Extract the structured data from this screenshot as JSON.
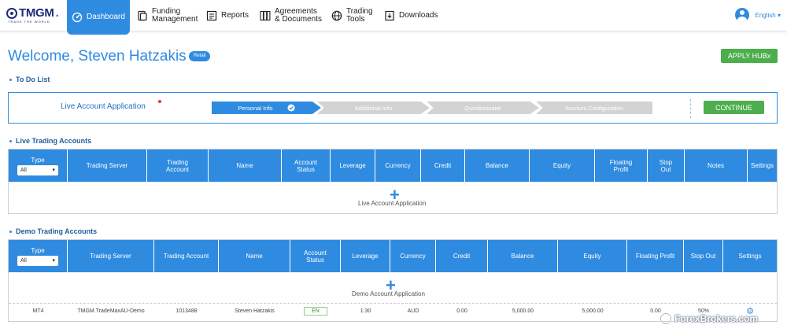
{
  "nav": {
    "logo_text": "TMGM",
    "logo_tagline": "TRADE THE WORLD",
    "items": [
      {
        "label_1": "Dashboard",
        "label_2": "",
        "icon": "dashboard-icon"
      },
      {
        "label_1": "Funding",
        "label_2": "Management",
        "icon": "wallet-icon"
      },
      {
        "label_1": "Reports",
        "label_2": "",
        "icon": "report-icon"
      },
      {
        "label_1": "Agreements",
        "label_2": "& Documents",
        "icon": "documents-icon"
      },
      {
        "label_1": "Trading",
        "label_2": "Tools",
        "icon": "globe-icon"
      },
      {
        "label_1": "Downloads",
        "label_2": "",
        "icon": "download-icon"
      }
    ],
    "language": "English",
    "language_caret": "▾"
  },
  "welcome": {
    "title": "Welcome, Steven Hatzakis",
    "badge": "Retail",
    "apply_button": "APPLY HUBx"
  },
  "todo": {
    "section_title": "To Do List",
    "label": "Live Account Application",
    "steps": [
      "Personal Info",
      "Additional Info",
      "Questionnaire",
      "Account Configuration"
    ],
    "active_step": 0,
    "continue_button": "CONTINUE"
  },
  "live": {
    "section_title": "Live Trading Accounts",
    "type_label": "Type",
    "type_value": "All",
    "headers": [
      [
        "Trading Server"
      ],
      [
        "Trading",
        "Account"
      ],
      [
        "Name"
      ],
      [
        "Account",
        "Status"
      ],
      [
        "Leverage"
      ],
      [
        "Currency"
      ],
      [
        "Credit"
      ],
      [
        "Balance"
      ],
      [
        "Equity"
      ],
      [
        "Floating",
        "Profit"
      ],
      [
        "Stop",
        "Out"
      ],
      [
        "Notes"
      ],
      [
        "Settings"
      ]
    ],
    "add_icon": "+",
    "add_label": "Live Account Application"
  },
  "demo": {
    "section_title": "Demo Trading Accounts",
    "type_label": "Type",
    "type_value": "All",
    "headers": [
      [
        "Trading Server"
      ],
      [
        "Trading Account"
      ],
      [
        "Name"
      ],
      [
        "Account",
        "Status"
      ],
      [
        "Leverage"
      ],
      [
        "Currency"
      ],
      [
        "Credit"
      ],
      [
        "Balance"
      ],
      [
        "Equity"
      ],
      [
        "Floating Profit"
      ],
      [
        "Stop Out"
      ],
      [
        "Settings"
      ]
    ],
    "add_icon": "+",
    "add_label": "Demo Account Application",
    "rows": [
      {
        "type": "MT4",
        "server": "TMGM.TradeMaxAU-Demo",
        "account": "1013488",
        "name": "Steven Hatzakis",
        "status": "EN",
        "leverage": "1:30",
        "currency": "AUD",
        "credit": "0.00",
        "balance": "5,000.00",
        "equity": "5,000.00",
        "floating_profit": "0.00",
        "stop_out": "50%"
      }
    ]
  },
  "watermark": "ForexBrokers.com",
  "colors": {
    "primary": "#2f8be0",
    "success": "#4cae4c",
    "alert": "#e53935"
  }
}
